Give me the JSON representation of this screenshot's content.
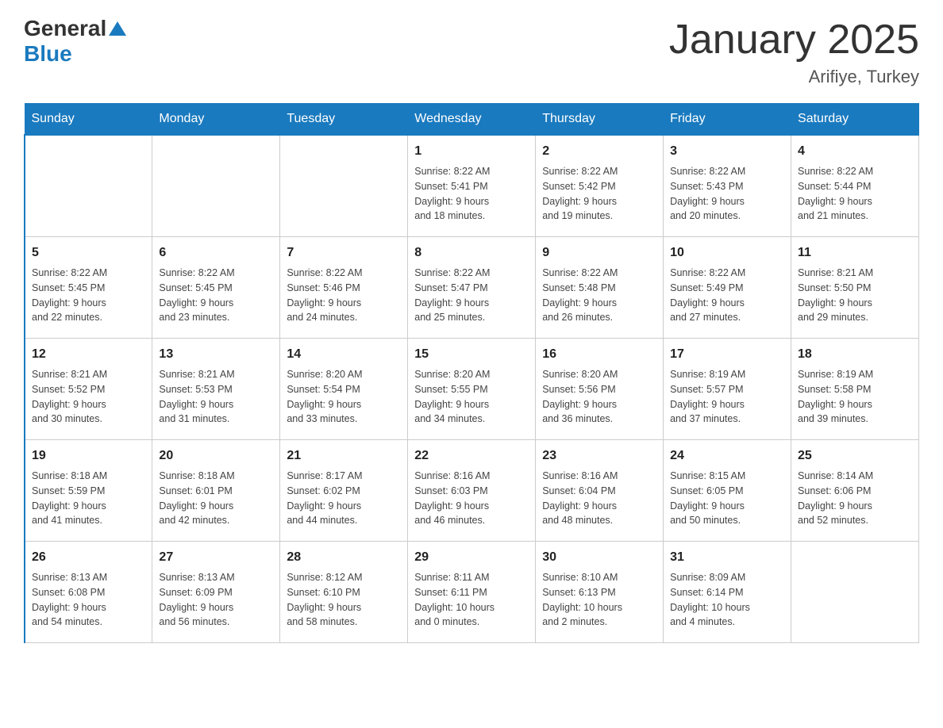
{
  "header": {
    "logo_general": "General",
    "logo_blue": "Blue",
    "title": "January 2025",
    "subtitle": "Arifiye, Turkey"
  },
  "days_of_week": [
    "Sunday",
    "Monday",
    "Tuesday",
    "Wednesday",
    "Thursday",
    "Friday",
    "Saturday"
  ],
  "weeks": [
    [
      {
        "day": "",
        "info": ""
      },
      {
        "day": "",
        "info": ""
      },
      {
        "day": "",
        "info": ""
      },
      {
        "day": "1",
        "info": "Sunrise: 8:22 AM\nSunset: 5:41 PM\nDaylight: 9 hours\nand 18 minutes."
      },
      {
        "day": "2",
        "info": "Sunrise: 8:22 AM\nSunset: 5:42 PM\nDaylight: 9 hours\nand 19 minutes."
      },
      {
        "day": "3",
        "info": "Sunrise: 8:22 AM\nSunset: 5:43 PM\nDaylight: 9 hours\nand 20 minutes."
      },
      {
        "day": "4",
        "info": "Sunrise: 8:22 AM\nSunset: 5:44 PM\nDaylight: 9 hours\nand 21 minutes."
      }
    ],
    [
      {
        "day": "5",
        "info": "Sunrise: 8:22 AM\nSunset: 5:45 PM\nDaylight: 9 hours\nand 22 minutes."
      },
      {
        "day": "6",
        "info": "Sunrise: 8:22 AM\nSunset: 5:45 PM\nDaylight: 9 hours\nand 23 minutes."
      },
      {
        "day": "7",
        "info": "Sunrise: 8:22 AM\nSunset: 5:46 PM\nDaylight: 9 hours\nand 24 minutes."
      },
      {
        "day": "8",
        "info": "Sunrise: 8:22 AM\nSunset: 5:47 PM\nDaylight: 9 hours\nand 25 minutes."
      },
      {
        "day": "9",
        "info": "Sunrise: 8:22 AM\nSunset: 5:48 PM\nDaylight: 9 hours\nand 26 minutes."
      },
      {
        "day": "10",
        "info": "Sunrise: 8:22 AM\nSunset: 5:49 PM\nDaylight: 9 hours\nand 27 minutes."
      },
      {
        "day": "11",
        "info": "Sunrise: 8:21 AM\nSunset: 5:50 PM\nDaylight: 9 hours\nand 29 minutes."
      }
    ],
    [
      {
        "day": "12",
        "info": "Sunrise: 8:21 AM\nSunset: 5:52 PM\nDaylight: 9 hours\nand 30 minutes."
      },
      {
        "day": "13",
        "info": "Sunrise: 8:21 AM\nSunset: 5:53 PM\nDaylight: 9 hours\nand 31 minutes."
      },
      {
        "day": "14",
        "info": "Sunrise: 8:20 AM\nSunset: 5:54 PM\nDaylight: 9 hours\nand 33 minutes."
      },
      {
        "day": "15",
        "info": "Sunrise: 8:20 AM\nSunset: 5:55 PM\nDaylight: 9 hours\nand 34 minutes."
      },
      {
        "day": "16",
        "info": "Sunrise: 8:20 AM\nSunset: 5:56 PM\nDaylight: 9 hours\nand 36 minutes."
      },
      {
        "day": "17",
        "info": "Sunrise: 8:19 AM\nSunset: 5:57 PM\nDaylight: 9 hours\nand 37 minutes."
      },
      {
        "day": "18",
        "info": "Sunrise: 8:19 AM\nSunset: 5:58 PM\nDaylight: 9 hours\nand 39 minutes."
      }
    ],
    [
      {
        "day": "19",
        "info": "Sunrise: 8:18 AM\nSunset: 5:59 PM\nDaylight: 9 hours\nand 41 minutes."
      },
      {
        "day": "20",
        "info": "Sunrise: 8:18 AM\nSunset: 6:01 PM\nDaylight: 9 hours\nand 42 minutes."
      },
      {
        "day": "21",
        "info": "Sunrise: 8:17 AM\nSunset: 6:02 PM\nDaylight: 9 hours\nand 44 minutes."
      },
      {
        "day": "22",
        "info": "Sunrise: 8:16 AM\nSunset: 6:03 PM\nDaylight: 9 hours\nand 46 minutes."
      },
      {
        "day": "23",
        "info": "Sunrise: 8:16 AM\nSunset: 6:04 PM\nDaylight: 9 hours\nand 48 minutes."
      },
      {
        "day": "24",
        "info": "Sunrise: 8:15 AM\nSunset: 6:05 PM\nDaylight: 9 hours\nand 50 minutes."
      },
      {
        "day": "25",
        "info": "Sunrise: 8:14 AM\nSunset: 6:06 PM\nDaylight: 9 hours\nand 52 minutes."
      }
    ],
    [
      {
        "day": "26",
        "info": "Sunrise: 8:13 AM\nSunset: 6:08 PM\nDaylight: 9 hours\nand 54 minutes."
      },
      {
        "day": "27",
        "info": "Sunrise: 8:13 AM\nSunset: 6:09 PM\nDaylight: 9 hours\nand 56 minutes."
      },
      {
        "day": "28",
        "info": "Sunrise: 8:12 AM\nSunset: 6:10 PM\nDaylight: 9 hours\nand 58 minutes."
      },
      {
        "day": "29",
        "info": "Sunrise: 8:11 AM\nSunset: 6:11 PM\nDaylight: 10 hours\nand 0 minutes."
      },
      {
        "day": "30",
        "info": "Sunrise: 8:10 AM\nSunset: 6:13 PM\nDaylight: 10 hours\nand 2 minutes."
      },
      {
        "day": "31",
        "info": "Sunrise: 8:09 AM\nSunset: 6:14 PM\nDaylight: 10 hours\nand 4 minutes."
      },
      {
        "day": "",
        "info": ""
      }
    ]
  ]
}
